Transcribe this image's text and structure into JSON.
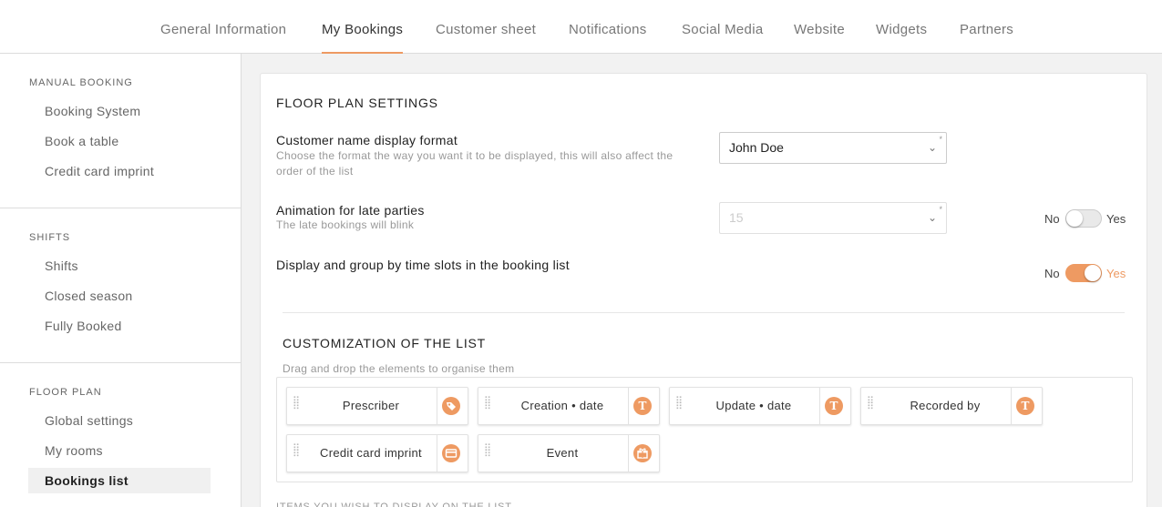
{
  "nav": {
    "tabs": [
      {
        "label": "General Information"
      },
      {
        "label": "My Bookings"
      },
      {
        "label": "Customer sheet"
      },
      {
        "label": "Notifications"
      },
      {
        "label": "Social Media"
      },
      {
        "label": "Website"
      },
      {
        "label": "Widgets"
      },
      {
        "label": "Partners"
      }
    ],
    "active_tab": "My Bookings"
  },
  "sidebar": {
    "sections": [
      {
        "heading": "MANUAL BOOKING",
        "items": [
          {
            "label": "Booking System"
          },
          {
            "label": "Book a table"
          },
          {
            "label": "Credit card imprint"
          }
        ]
      },
      {
        "heading": "SHIFTS",
        "items": [
          {
            "label": "Shifts"
          },
          {
            "label": "Closed season"
          },
          {
            "label": "Fully Booked"
          }
        ]
      },
      {
        "heading": "FLOOR PLAN",
        "items": [
          {
            "label": "Global settings"
          },
          {
            "label": "My rooms"
          },
          {
            "label": "Bookings list"
          }
        ]
      }
    ],
    "active_item": "Bookings list"
  },
  "floor_plan": {
    "title": "FLOOR PLAN SETTINGS",
    "settings": [
      {
        "label": "Customer name display format",
        "description": "Choose the format the way you want it to be displayed, this will also affect the order of the list",
        "select_value": "John Doe",
        "required_mark": "*"
      },
      {
        "label": "Animation for late parties",
        "description": "The late bookings will blink",
        "select_value": "15",
        "required_mark": "*",
        "toggle": {
          "no": "No",
          "yes": "Yes",
          "on": false
        }
      },
      {
        "label": "Display and group by time slots in the booking list",
        "toggle": {
          "no": "No",
          "yes": "Yes",
          "on": true
        }
      }
    ]
  },
  "customization": {
    "title": "CUSTOMIZATION OF THE LIST",
    "hint": "Drag and drop the elements to organise them",
    "items": [
      {
        "label": "Prescriber",
        "icon": "tag-icon"
      },
      {
        "label": "Creation • date",
        "icon": "text-type-icon"
      },
      {
        "label": "Update • date",
        "icon": "text-type-icon"
      },
      {
        "label": "Recorded by",
        "icon": "text-type-icon"
      },
      {
        "label": "Credit card imprint",
        "icon": "credit-card-icon"
      },
      {
        "label": "Event",
        "icon": "gift-icon"
      }
    ],
    "next_section_title": "ITEMS YOU WISH TO DISPLAY ON THE LIST"
  },
  "colors": {
    "accent": "#ee9a62",
    "toggle_off": "#e9e9e9"
  }
}
